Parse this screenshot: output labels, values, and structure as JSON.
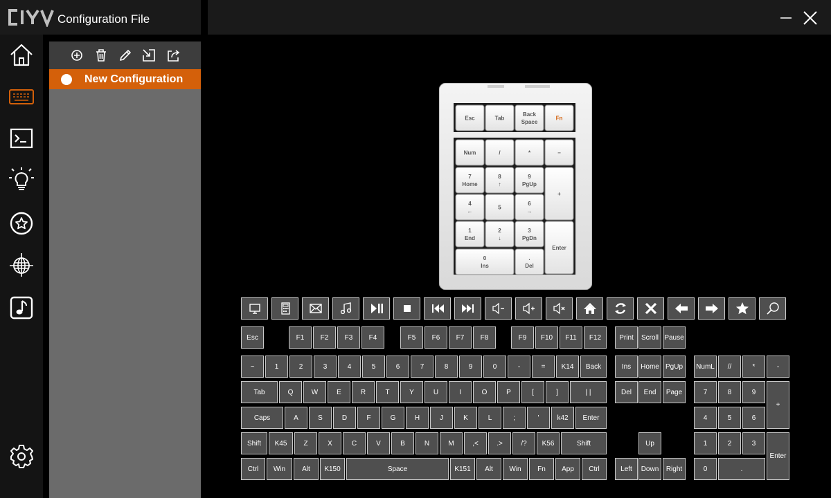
{
  "app": {
    "logo_text": "CIY",
    "title": "Configuration File"
  },
  "window_controls": [
    {
      "name": "minimize",
      "icon": "minimize-icon"
    },
    {
      "name": "close",
      "icon": "close-icon"
    }
  ],
  "sidebar": {
    "items": [
      {
        "icon": "home-icon",
        "active": false
      },
      {
        "icon": "keyboard-icon",
        "active": true
      },
      {
        "icon": "terminal-icon",
        "active": false
      },
      {
        "icon": "lightbulb-icon",
        "active": false
      },
      {
        "icon": "star-circle-icon",
        "active": false
      },
      {
        "icon": "globe-icon",
        "active": false
      },
      {
        "icon": "music-icon",
        "active": false
      }
    ],
    "settings_icon": "gear-icon"
  },
  "config_panel": {
    "toolbar": [
      "add-icon",
      "trash-icon",
      "pencil-icon",
      "import-icon",
      "export-icon"
    ],
    "items": [
      {
        "label": "New Configuration",
        "selected": true
      }
    ]
  },
  "keypad": {
    "rows": [
      [
        {
          "t": "Esc"
        },
        {
          "t": "Tab"
        },
        {
          "t": "Back\nSpace"
        },
        {
          "t": "Fn",
          "accent": true
        }
      ],
      [
        {
          "t": "Num"
        },
        {
          "t": "/"
        },
        {
          "t": "*"
        },
        {
          "t": "−"
        }
      ],
      [
        {
          "t": "7\nHome"
        },
        {
          "t": "8\n↑"
        },
        {
          "t": "9\nPgUp"
        },
        {
          "t": "+"
        }
      ],
      [
        {
          "t": "4\n←"
        },
        {
          "t": "5"
        },
        {
          "t": "6\n→"
        }
      ],
      [
        {
          "t": "1\nEnd"
        },
        {
          "t": "2\n↓"
        },
        {
          "t": "3\nPgDn"
        },
        {
          "t": "Enter"
        }
      ],
      [
        {
          "t": "0\nIns"
        },
        {
          "t": ".\nDel"
        }
      ]
    ]
  },
  "media_keys": [
    "monitor-icon",
    "calculator-icon",
    "mail-icon",
    "music-note-icon",
    "play-pause-icon",
    "stop-icon",
    "previous-track-icon",
    "next-track-icon",
    "volume-down-icon",
    "volume-up-icon",
    "mute-icon",
    "browser-home-icon",
    "refresh-icon",
    "close-x-icon",
    "back-arrow-icon",
    "forward-arrow-icon",
    "favorites-icon",
    "search-icon"
  ],
  "keys": [
    {
      "label": "Esc"
    },
    {
      "label": "F1"
    },
    {
      "label": "F2"
    },
    {
      "label": "F3"
    },
    {
      "label": "F4"
    },
    {
      "label": "F5"
    },
    {
      "label": "F6"
    },
    {
      "label": "F7"
    },
    {
      "label": "F8"
    },
    {
      "label": "F9"
    },
    {
      "label": "F10"
    },
    {
      "label": "F11"
    },
    {
      "label": "F12"
    },
    {
      "label": "Print"
    },
    {
      "label": "Scroll"
    },
    {
      "label": "Pause"
    },
    {
      "label": "~"
    },
    {
      "label": "1"
    },
    {
      "label": "2"
    },
    {
      "label": "3"
    },
    {
      "label": "4"
    },
    {
      "label": "5"
    },
    {
      "label": "6"
    },
    {
      "label": "7"
    },
    {
      "label": "8"
    },
    {
      "label": "9"
    },
    {
      "label": "0"
    },
    {
      "label": "-"
    },
    {
      "label": "="
    },
    {
      "label": "K14"
    },
    {
      "label": "Back"
    },
    {
      "label": "Ins"
    },
    {
      "label": "Home"
    },
    {
      "label": "PgUp"
    },
    {
      "label": "NumL"
    },
    {
      "label": "//"
    },
    {
      "label": "*"
    },
    {
      "label": "-"
    },
    {
      "label": "Tab"
    },
    {
      "label": "Q"
    },
    {
      "label": "W"
    },
    {
      "label": "E"
    },
    {
      "label": "R"
    },
    {
      "label": "T"
    },
    {
      "label": "Y"
    },
    {
      "label": "U"
    },
    {
      "label": "I"
    },
    {
      "label": "O"
    },
    {
      "label": "P"
    },
    {
      "label": "["
    },
    {
      "label": "]"
    },
    {
      "label": "| |"
    },
    {
      "label": "Del"
    },
    {
      "label": "End"
    },
    {
      "label": "Page"
    },
    {
      "label": "7"
    },
    {
      "label": "8"
    },
    {
      "label": "9"
    },
    {
      "label": "+"
    },
    {
      "label": "Caps"
    },
    {
      "label": "A"
    },
    {
      "label": "S"
    },
    {
      "label": "D"
    },
    {
      "label": "F"
    },
    {
      "label": "G"
    },
    {
      "label": "H"
    },
    {
      "label": "J"
    },
    {
      "label": "K"
    },
    {
      "label": "L"
    },
    {
      "label": ";"
    },
    {
      "label": "'"
    },
    {
      "label": "k42"
    },
    {
      "label": "Enter"
    },
    {
      "label": "4"
    },
    {
      "label": "5"
    },
    {
      "label": "6"
    },
    {
      "label": "Shift"
    },
    {
      "label": "K45"
    },
    {
      "label": "Z"
    },
    {
      "label": "X"
    },
    {
      "label": "C"
    },
    {
      "label": "V"
    },
    {
      "label": "B"
    },
    {
      "label": "N"
    },
    {
      "label": "M"
    },
    {
      "label": ",<"
    },
    {
      "label": ".>"
    },
    {
      "label": "/?"
    },
    {
      "label": "K56"
    },
    {
      "label": "Shift"
    },
    {
      "label": "Up"
    },
    {
      "label": "1"
    },
    {
      "label": "2"
    },
    {
      "label": "3"
    },
    {
      "label": "Enter"
    },
    {
      "label": "Ctrl"
    },
    {
      "label": "Win"
    },
    {
      "label": "Alt"
    },
    {
      "label": "K150"
    },
    {
      "label": "Space"
    },
    {
      "label": "K151"
    },
    {
      "label": "Alt"
    },
    {
      "label": "Win"
    },
    {
      "label": "Fn"
    },
    {
      "label": "App"
    },
    {
      "label": "Ctrl"
    },
    {
      "label": "Left"
    },
    {
      "label": "Down"
    },
    {
      "label": "Right"
    },
    {
      "label": "0"
    },
    {
      "label": "."
    }
  ],
  "colors": {
    "accent": "#d4600a",
    "key_bg": "#4f4f4f",
    "key_border": "#c8c8c8",
    "panel_bg": "#6b6b6b",
    "toolbar_bg": "#3d3d3d",
    "titlebar_bg": "#1a1a1a",
    "sidebar_bg": "#141414"
  }
}
